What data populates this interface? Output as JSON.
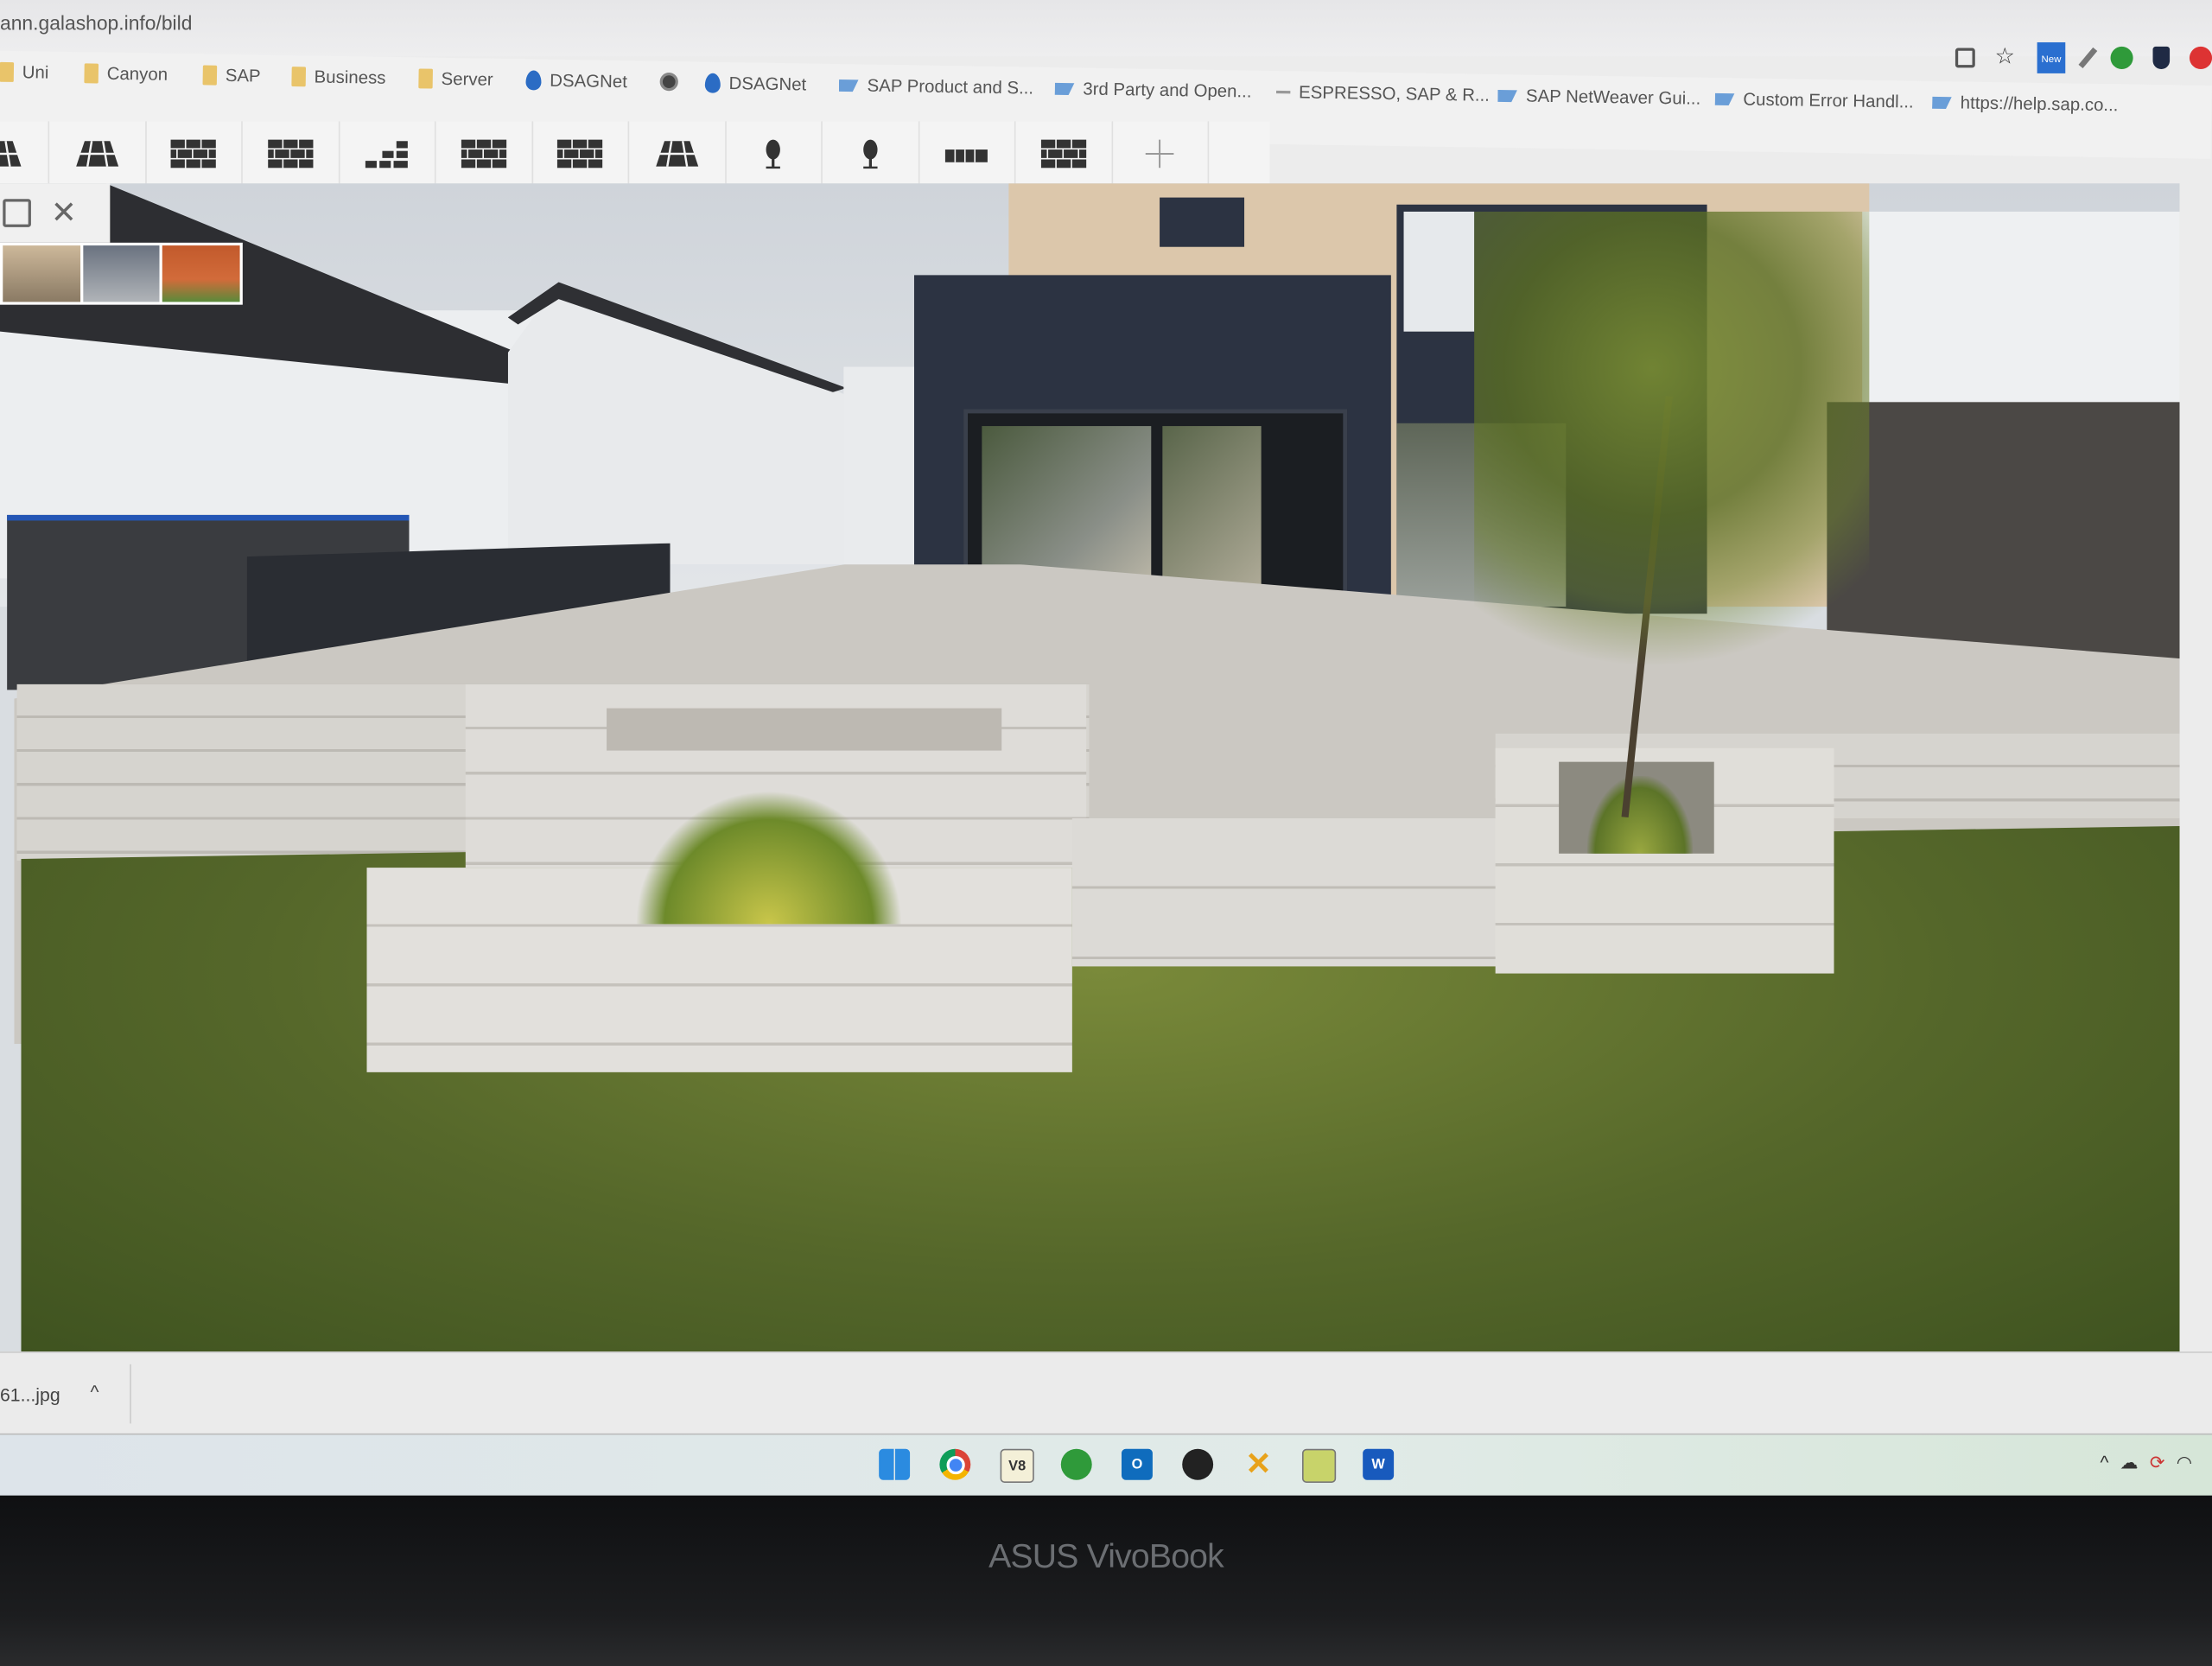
{
  "browser": {
    "url": "ann.galashop.info/bild",
    "bookmarks": [
      {
        "label": "Uni",
        "icon": "folder-icon"
      },
      {
        "label": "Canyon",
        "icon": "folder-icon"
      },
      {
        "label": "SAP",
        "icon": "folder-icon"
      },
      {
        "label": "Business",
        "icon": "folder-icon"
      },
      {
        "label": "Server",
        "icon": "folder-icon"
      },
      {
        "label": "DSAGNet",
        "icon": "drupal-drop-icon"
      },
      {
        "label": "",
        "icon": "globe-icon"
      },
      {
        "label": "DSAGNet",
        "icon": "drupal-drop-icon"
      },
      {
        "label": "SAP Product and S...",
        "icon": "sap-logo-icon"
      },
      {
        "label": "3rd Party and Open...",
        "icon": "sap-logo-icon"
      },
      {
        "label": "ESPRESSO, SAP & R...",
        "icon": "dash-icon"
      },
      {
        "label": "SAP NetWeaver Gui...",
        "icon": "sap-logo-icon"
      },
      {
        "label": "Custom Error Handl...",
        "icon": "sap-logo-icon"
      },
      {
        "label": "https://help.sap.co...",
        "icon": "sap-logo-icon"
      }
    ],
    "extensions": [
      "share-icon",
      "star-icon",
      "new-extension-icon",
      "eyedropper-icon",
      "evernote-icon",
      "shield-icon",
      "adblock-stop-icon"
    ],
    "extension_badge": "New"
  },
  "editor": {
    "tools": [
      "paving-icon",
      "paving-icon",
      "wall-icon",
      "wall-icon",
      "steps-icon",
      "wall-icon",
      "wall-icon",
      "paving-icon",
      "tree-icon",
      "tree-icon",
      "fence-icon",
      "wall-icon",
      "add-icon"
    ],
    "side_buttons": [
      "save-icon",
      "close-icon"
    ],
    "thumbnails": 3,
    "colors": {
      "grass": "#5b6e2a",
      "paving": "#cbc8c2",
      "facade_dark": "#2c3342"
    }
  },
  "downloads": {
    "file": "61...jpg",
    "chevron": "^"
  },
  "taskbar": {
    "apps": [
      "windows-start-icon",
      "chrome-icon",
      "vb-app-icon",
      "evernote-icon",
      "outlook-icon",
      "app-icon",
      "xmind-icon",
      "notepad-chart-icon",
      "word-icon"
    ],
    "tray": [
      "chevron-up-icon",
      "cloud-icon",
      "sync-icon",
      "wifi-icon"
    ],
    "tray_chevron": "^"
  },
  "laptop": {
    "brand": "ASUS VivoBook"
  }
}
